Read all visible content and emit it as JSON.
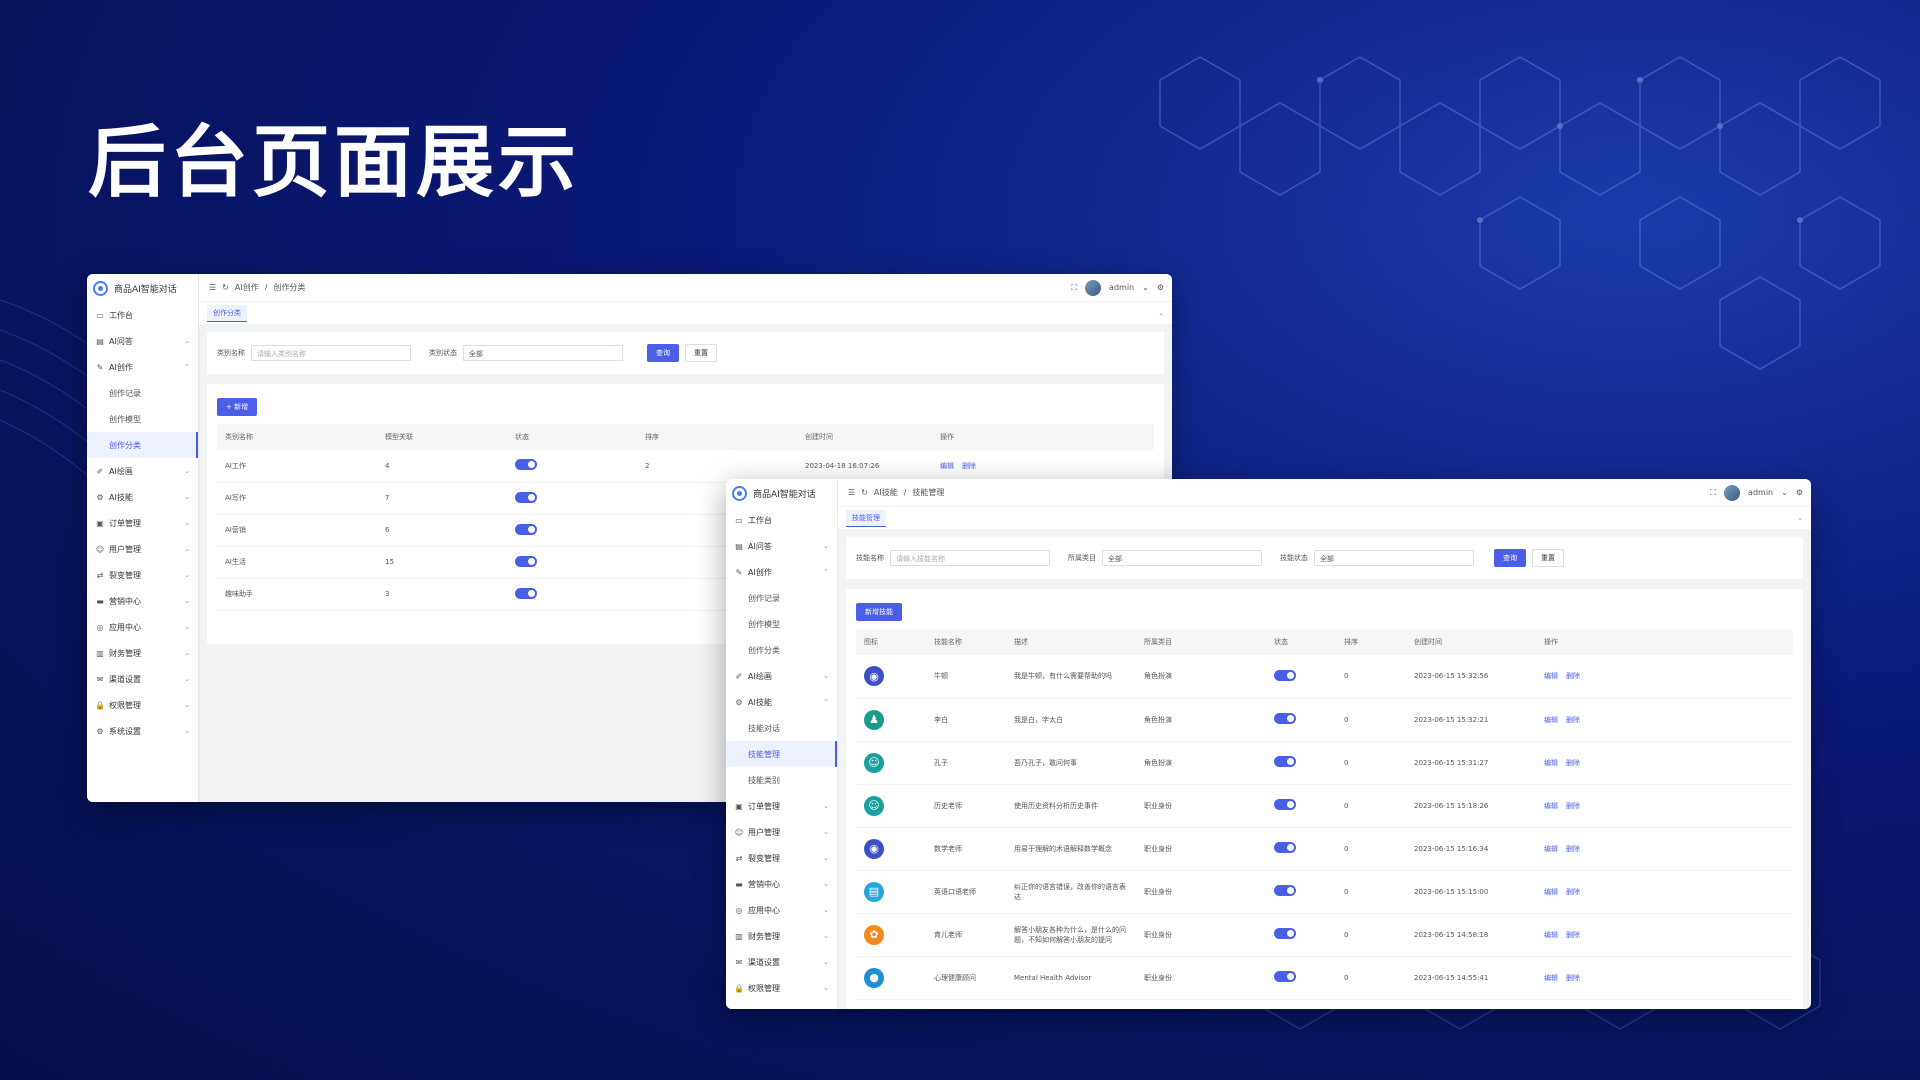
{
  "slide": {
    "title": "后台页面展示"
  },
  "w1": {
    "brand": "商品AI智能对话",
    "breadcrumb": [
      "AI创作",
      "创作分类"
    ],
    "user": "admin",
    "tab": "创作分类",
    "menu": [
      {
        "label": "工作台",
        "icon": "monitor-icon",
        "chev": ""
      },
      {
        "label": "AI问答",
        "icon": "chat-icon",
        "chev": "⌄"
      },
      {
        "label": "AI创作",
        "icon": "edit-icon",
        "chev": "⌃"
      },
      {
        "label": "创作记录",
        "sub": true
      },
      {
        "label": "创作模型",
        "sub": true
      },
      {
        "label": "创作分类",
        "sub": true,
        "active": true
      },
      {
        "label": "AI绘画",
        "icon": "brush-icon",
        "chev": "⌄"
      },
      {
        "label": "AI技能",
        "icon": "gear-icon",
        "chev": "⌄"
      },
      {
        "label": "订单管理",
        "icon": "order-icon",
        "chev": "⌄"
      },
      {
        "label": "用户管理",
        "icon": "user-icon",
        "chev": "⌄"
      },
      {
        "label": "裂变管理",
        "icon": "share-icon",
        "chev": "⌄"
      },
      {
        "label": "营销中心",
        "icon": "marketing-icon",
        "chev": "⌄"
      },
      {
        "label": "应用中心",
        "icon": "app-icon",
        "chev": "⌄"
      },
      {
        "label": "财务管理",
        "icon": "finance-icon",
        "chev": "⌄"
      },
      {
        "label": "渠道设置",
        "icon": "channel-icon",
        "chev": "⌄"
      },
      {
        "label": "权限管理",
        "icon": "lock-icon",
        "chev": "⌄"
      },
      {
        "label": "系统设置",
        "icon": "settings-icon",
        "chev": "⌄"
      }
    ],
    "filter": {
      "name_label": "类别名称",
      "name_placeholder": "请输入类别名称",
      "status_label": "类别状态",
      "status_value": "全部",
      "query": "查询",
      "reset": "重置"
    },
    "add_button": "+ 新增",
    "columns": [
      "类别名称",
      "模型关联",
      "状态",
      "排序",
      "创建时间",
      "操作"
    ],
    "rows": [
      {
        "name": "AI工作",
        "count": "4",
        "sort": "2",
        "time": "2023-04-18 16:07:26"
      },
      {
        "name": "AI写作",
        "count": "7",
        "sort": "",
        "time": ""
      },
      {
        "name": "AI营销",
        "count": "6",
        "sort": "",
        "time": ""
      },
      {
        "name": "AI生活",
        "count": "15",
        "sort": "",
        "time": ""
      },
      {
        "name": "趣味助手",
        "count": "3",
        "sort": "",
        "time": ""
      }
    ],
    "edit": "编辑",
    "delete": "删除"
  },
  "w2": {
    "brand": "商品AI智能对话",
    "breadcrumb": [
      "AI技能",
      "技能管理"
    ],
    "user": "admin",
    "tab": "技能管理",
    "menu": [
      {
        "label": "工作台",
        "icon": "monitor-icon",
        "chev": ""
      },
      {
        "label": "AI问答",
        "icon": "chat-icon",
        "chev": "⌄"
      },
      {
        "label": "AI创作",
        "icon": "edit-icon",
        "chev": "⌃"
      },
      {
        "label": "创作记录",
        "sub": true
      },
      {
        "label": "创作模型",
        "sub": true
      },
      {
        "label": "创作分类",
        "sub": true
      },
      {
        "label": "AI绘画",
        "icon": "brush-icon",
        "chev": "⌄"
      },
      {
        "label": "AI技能",
        "icon": "gear-icon",
        "chev": "⌃"
      },
      {
        "label": "技能对话",
        "sub": true
      },
      {
        "label": "技能管理",
        "sub": true,
        "active": true
      },
      {
        "label": "技能类别",
        "sub": true
      },
      {
        "label": "订单管理",
        "icon": "order-icon",
        "chev": "⌄"
      },
      {
        "label": "用户管理",
        "icon": "user-icon",
        "chev": "⌄"
      },
      {
        "label": "裂变管理",
        "icon": "share-icon",
        "chev": "⌄"
      },
      {
        "label": "营销中心",
        "icon": "marketing-icon",
        "chev": "⌄"
      },
      {
        "label": "应用中心",
        "icon": "app-icon",
        "chev": "⌄"
      },
      {
        "label": "财务管理",
        "icon": "finance-icon",
        "chev": "⌄"
      },
      {
        "label": "渠道设置",
        "icon": "channel-icon",
        "chev": "⌄"
      },
      {
        "label": "权限管理",
        "icon": "lock-icon",
        "chev": "⌄"
      }
    ],
    "filter": {
      "name_label": "技能名称",
      "name_placeholder": "请输入技能名称",
      "cat_label": "所属类目",
      "cat_value": "全部",
      "status_label": "技能状态",
      "status_value": "全部",
      "query": "查询",
      "reset": "重置"
    },
    "add_button": "新增技能",
    "columns": [
      "图标",
      "技能名称",
      "描述",
      "所属类目",
      "状态",
      "排序",
      "创建时间",
      "操作"
    ],
    "rows": [
      {
        "icon": "bulb-icon",
        "color": "#3d4fc4",
        "name": "牛顿",
        "desc": "我是牛顿，有什么需要帮助的吗",
        "cat": "角色扮演",
        "sort": "0",
        "time": "2023-06-15 15:32:56"
      },
      {
        "icon": "person-icon",
        "color": "#1c9a8a",
        "name": "李白",
        "desc": "我是白，字太白",
        "cat": "角色扮演",
        "sort": "0",
        "time": "2023-06-15 15:32:21"
      },
      {
        "icon": "smile-icon",
        "color": "#1aa0a0",
        "name": "孔子",
        "desc": "吾乃孔子，敢问何事",
        "cat": "角色扮演",
        "sort": "0",
        "time": "2023-06-15 15:31:27"
      },
      {
        "icon": "smile-icon",
        "color": "#1aa0a0",
        "name": "历史老师",
        "desc": "使用历史资料分析历史事件",
        "cat": "职业身份",
        "sort": "0",
        "time": "2023-06-15 15:18:26"
      },
      {
        "icon": "bulb-icon",
        "color": "#3d4fc4",
        "name": "数学老师",
        "desc": "用易于理解的术语解释数学概念",
        "cat": "职业身份",
        "sort": "0",
        "time": "2023-06-15 15:16:34"
      },
      {
        "icon": "briefcase-icon",
        "color": "#25a6d9",
        "name": "英语口语老师",
        "desc": "纠正你的语言错误，改善你的语言表达",
        "cat": "职业身份",
        "sort": "0",
        "time": "2023-06-15 15:15:00"
      },
      {
        "icon": "flower-icon",
        "color": "#f28a1e",
        "name": "育儿老师",
        "desc": "解答小朋友各种为什么，是什么的问题，不知如何解答小朋友的提问",
        "cat": "职业身份",
        "sort": "0",
        "time": "2023-06-15 14:58:18"
      },
      {
        "icon": "drop-icon",
        "color": "#1c8fd6",
        "name": "心理健康顾问",
        "desc": "Mental Health Advisor",
        "cat": "职业身份",
        "sort": "0",
        "time": "2023-06-15 14:55:41"
      }
    ],
    "edit": "编辑",
    "delete": "删除"
  }
}
